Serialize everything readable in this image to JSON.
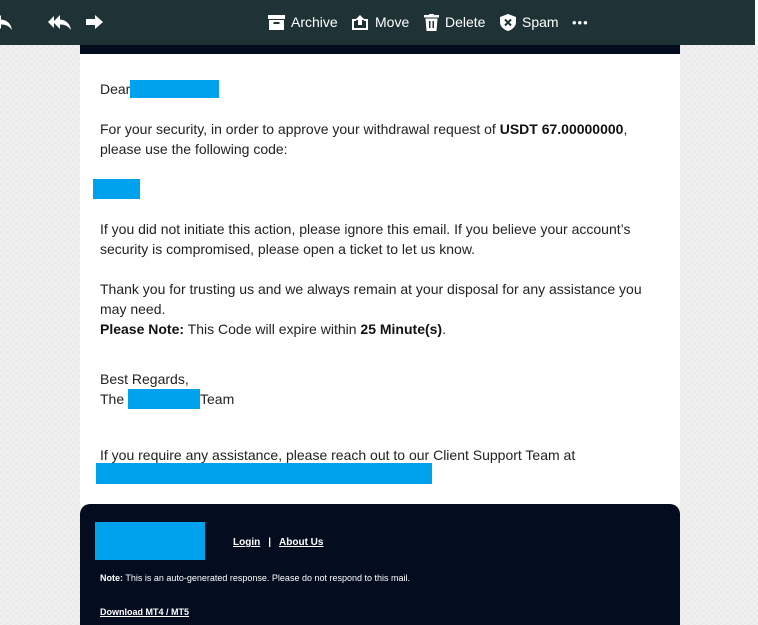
{
  "toolbar": {
    "archive_label": "Archive",
    "move_label": "Move",
    "delete_label": "Delete",
    "spam_label": "Spam",
    "more_label": "•••",
    "icons": [
      "reply-icon",
      "reply-all-icon",
      "forward-icon",
      "archive-icon",
      "move-icon",
      "delete-icon",
      "spam-icon",
      "more-icon"
    ]
  },
  "email": {
    "greeting": "Dear",
    "security_text_1": "For your security, in order to approve your withdrawal request of ",
    "amount": "USDT 67.00000000",
    "security_text_1_end": ",",
    "security_text_2": "please use the following code:",
    "ignore_text_1": "If you did not initiate this action, please ignore this email. If you believe your account’s",
    "ignore_text_2": "security is compromised, please open a ticket to let us know.",
    "thanks_text_1": "Thank you for trusting us and we always remain at your disposal for any assistance you",
    "thanks_text_2": "may need.",
    "note_label": "Please Note:",
    "note_text": " This Code will expire within ",
    "expiry": "25 Minute(s)",
    "note_end": ".",
    "regards": "Best Regards,",
    "team_prefix": "The",
    "team_suffix": "Team",
    "support_text": "If you require any assistance, please reach out to our Client Support Team at"
  },
  "footer": {
    "login_label": "Login",
    "separator": "|",
    "about_label": "About Us",
    "note_label": "Note:",
    "note_text": " This is an auto-generated response. Please do not respond to this mail.",
    "download_label": "Download MT4 / MT5"
  },
  "colors": {
    "toolbar_bg": "#1f3336",
    "redaction": "#00a2ed",
    "footer_bg": "#030d1f"
  }
}
